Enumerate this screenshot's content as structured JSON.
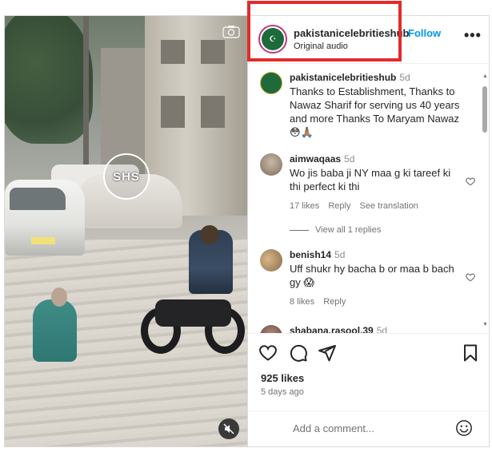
{
  "post": {
    "username": "pakistanicelebritieshub",
    "audio": "Original audio",
    "follow_label": "Follow",
    "more_label": "•••",
    "video_watermark": "SHS"
  },
  "comments": [
    {
      "username": "pakistanicelebritieshub",
      "time": "5d",
      "text": "Thanks to Establishment, Thanks to Nawaz Sharif for serving us 40 years and more Thanks To Maryam Nawaz 😳🙏🏽"
    },
    {
      "username": "aimwaqaas",
      "time": "5d",
      "text": "Wo jis baba ji NY maa g ki tareef ki thi perfect ki thi",
      "likes": "17 likes",
      "reply": "Reply",
      "see_translation": "See translation",
      "view_replies": "View all 1 replies"
    },
    {
      "username": "benish14",
      "time": "5d",
      "text": "Uff shukr hy bacha b or maa b bach gy 😱",
      "likes": "8 likes",
      "reply": "Reply"
    },
    {
      "username": "shabana.rasool.39",
      "time": "5d"
    }
  ],
  "footer": {
    "likes": "925 likes",
    "date": "5 days ago",
    "add_comment_placeholder": "Add a comment..."
  },
  "icons": [
    "camera-icon",
    "mute-icon",
    "heart-icon",
    "comment-icon",
    "share-icon",
    "bookmark-icon",
    "emoji-icon",
    "more-icon"
  ],
  "colors": {
    "follow": "#0095f6",
    "highlight_box": "#e32b2b",
    "text": "#262626",
    "muted": "#737373"
  }
}
